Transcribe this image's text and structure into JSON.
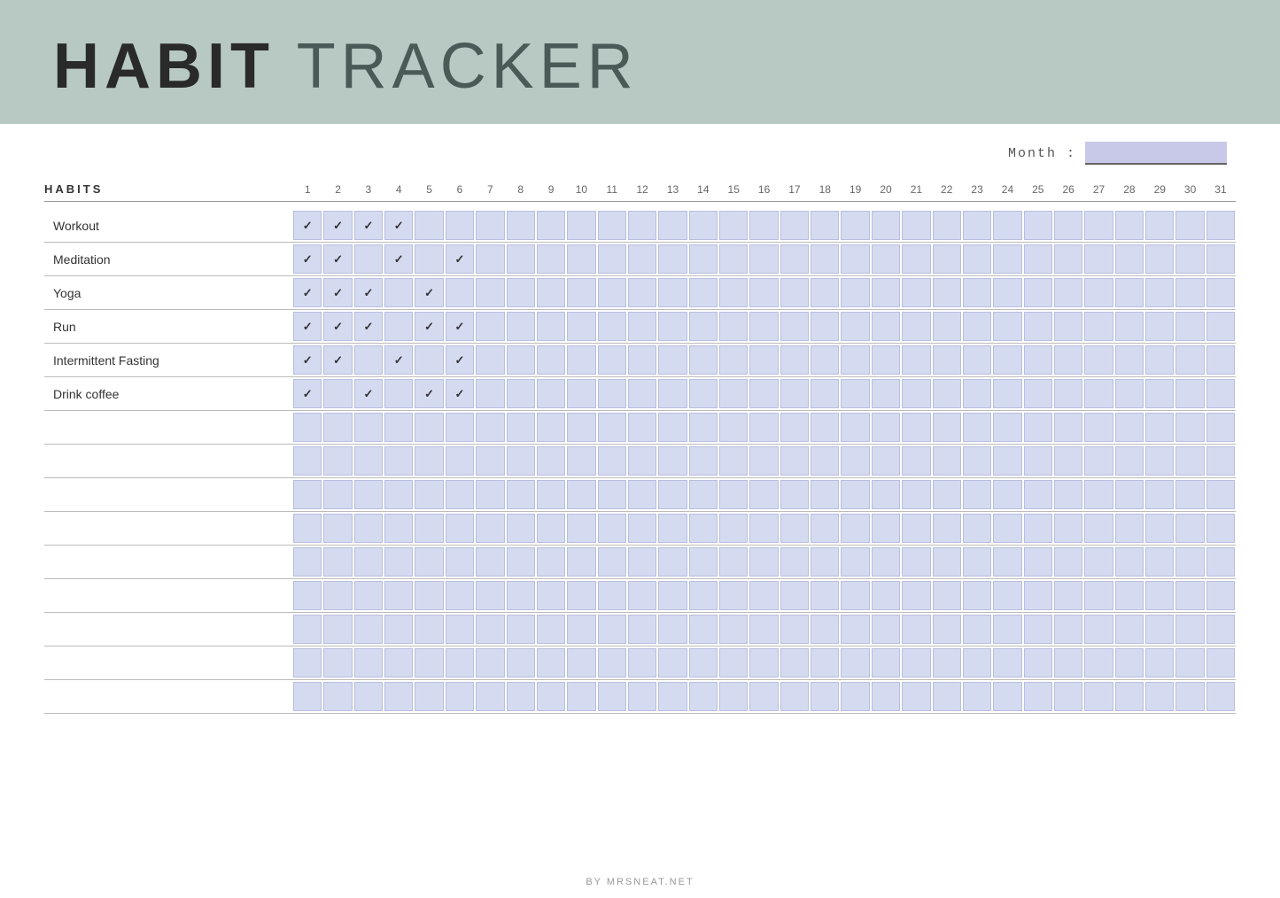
{
  "header": {
    "title_bold": "HABIT",
    "title_light": " TRACKER"
  },
  "month_label": "Month :",
  "month_value": "",
  "habits_column_label": "HABITS",
  "days": [
    1,
    2,
    3,
    4,
    5,
    6,
    7,
    8,
    9,
    10,
    11,
    12,
    13,
    14,
    15,
    16,
    17,
    18,
    19,
    20,
    21,
    22,
    23,
    24,
    25,
    26,
    27,
    28,
    29,
    30,
    31
  ],
  "habits": [
    {
      "name": "Workout",
      "checked_days": [
        1,
        2,
        3,
        4
      ]
    },
    {
      "name": "Meditation",
      "checked_days": [
        1,
        2,
        4,
        6
      ]
    },
    {
      "name": "Yoga",
      "checked_days": [
        1,
        2,
        3,
        5
      ]
    },
    {
      "name": "Run",
      "checked_days": [
        1,
        2,
        3,
        5,
        6
      ]
    },
    {
      "name": "Intermittent Fasting",
      "checked_days": [
        1,
        2,
        4,
        6
      ]
    },
    {
      "name": "Drink coffee",
      "checked_days": [
        1,
        3,
        5,
        6
      ]
    },
    {
      "name": "",
      "checked_days": []
    },
    {
      "name": "",
      "checked_days": []
    },
    {
      "name": "",
      "checked_days": []
    },
    {
      "name": "",
      "checked_days": []
    },
    {
      "name": "",
      "checked_days": []
    },
    {
      "name": "",
      "checked_days": []
    },
    {
      "name": "",
      "checked_days": []
    },
    {
      "name": "",
      "checked_days": []
    },
    {
      "name": "",
      "checked_days": []
    }
  ],
  "footer_text": "BY MRSNEAT.NET"
}
